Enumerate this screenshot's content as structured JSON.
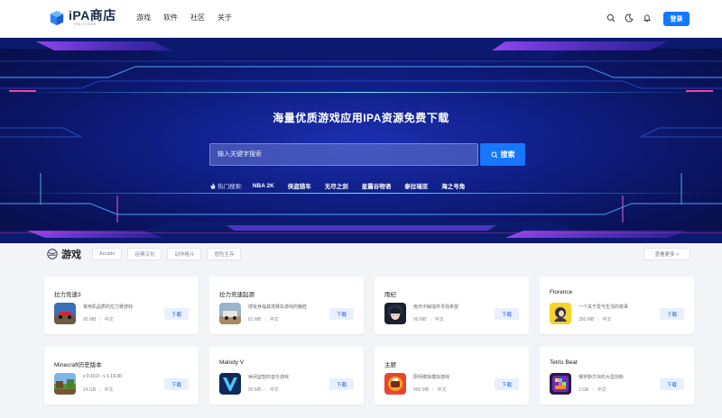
{
  "header": {
    "logo_title": "iPA商店",
    "logo_sub": "IPA STORE",
    "nav": [
      "游戏",
      "软件",
      "社区",
      "关于"
    ],
    "login_label": "登录",
    "icons": [
      "search-icon",
      "moon-icon",
      "bell-icon"
    ]
  },
  "hero": {
    "title": "海量优质游戏应用IPA资源免费下载",
    "search_placeholder": "输入关键字搜索",
    "search_button": "搜索",
    "hot_label": "热门搜索:",
    "hot_items": [
      "NBA 2K",
      "侠盗猎车",
      "无尽之剑",
      "星露谷物语",
      "泰拉瑞亚",
      "海之号角"
    ]
  },
  "section": {
    "title": "游戏",
    "tags": [
      "Arcade",
      "经典汉化",
      "动作格斗",
      "冒险生存"
    ],
    "more_label": "查看更多 >"
  },
  "cards": [
    {
      "name": "拉力竞速3",
      "desc": "掌用机品质的拉力赛游戏",
      "size": "92 MB",
      "lang": "中文",
      "btn": "下载",
      "thumb": "car-red"
    },
    {
      "name": "拉力竞速起源",
      "desc": "感受身临其境赛车游戏的魅胜",
      "size": "81 MB",
      "lang": "中文",
      "btn": "下载",
      "thumb": "car-jeep"
    },
    {
      "name": "雨纪",
      "desc": "雨天中解谜并寻找希望",
      "size": "90 MB",
      "lang": "中文",
      "btn": "下载",
      "thumb": "anime"
    },
    {
      "name": "Florence",
      "desc": "一个关于爱与生活的故事",
      "size": "350 MB",
      "lang": "中文",
      "btn": "下载",
      "thumb": "florence"
    },
    {
      "name": "Minecraft历史版本",
      "desc": "v 0.10.0 - v 1.19.30",
      "size": "14 GB",
      "lang": "中文",
      "btn": "下载",
      "thumb": "minecraft"
    },
    {
      "name": "Malody V",
      "desc": "休闲益智的音乐游戏",
      "size": "90 MB",
      "lang": "中文",
      "btn": "下载",
      "thumb": "malody"
    },
    {
      "name": "主厨",
      "desc": "厨师做饭模拟游戏",
      "size": "400 MB",
      "lang": "中文",
      "btn": "下载",
      "thumb": "chef"
    },
    {
      "name": "Tetris Beat",
      "desc": "俄罗斯方块的大型创新",
      "size": "1 GB",
      "lang": "中文",
      "btn": "下载",
      "thumb": "tetris"
    }
  ],
  "colors": {
    "accent": "#1677ff",
    "hero_bg": "#10208a"
  }
}
